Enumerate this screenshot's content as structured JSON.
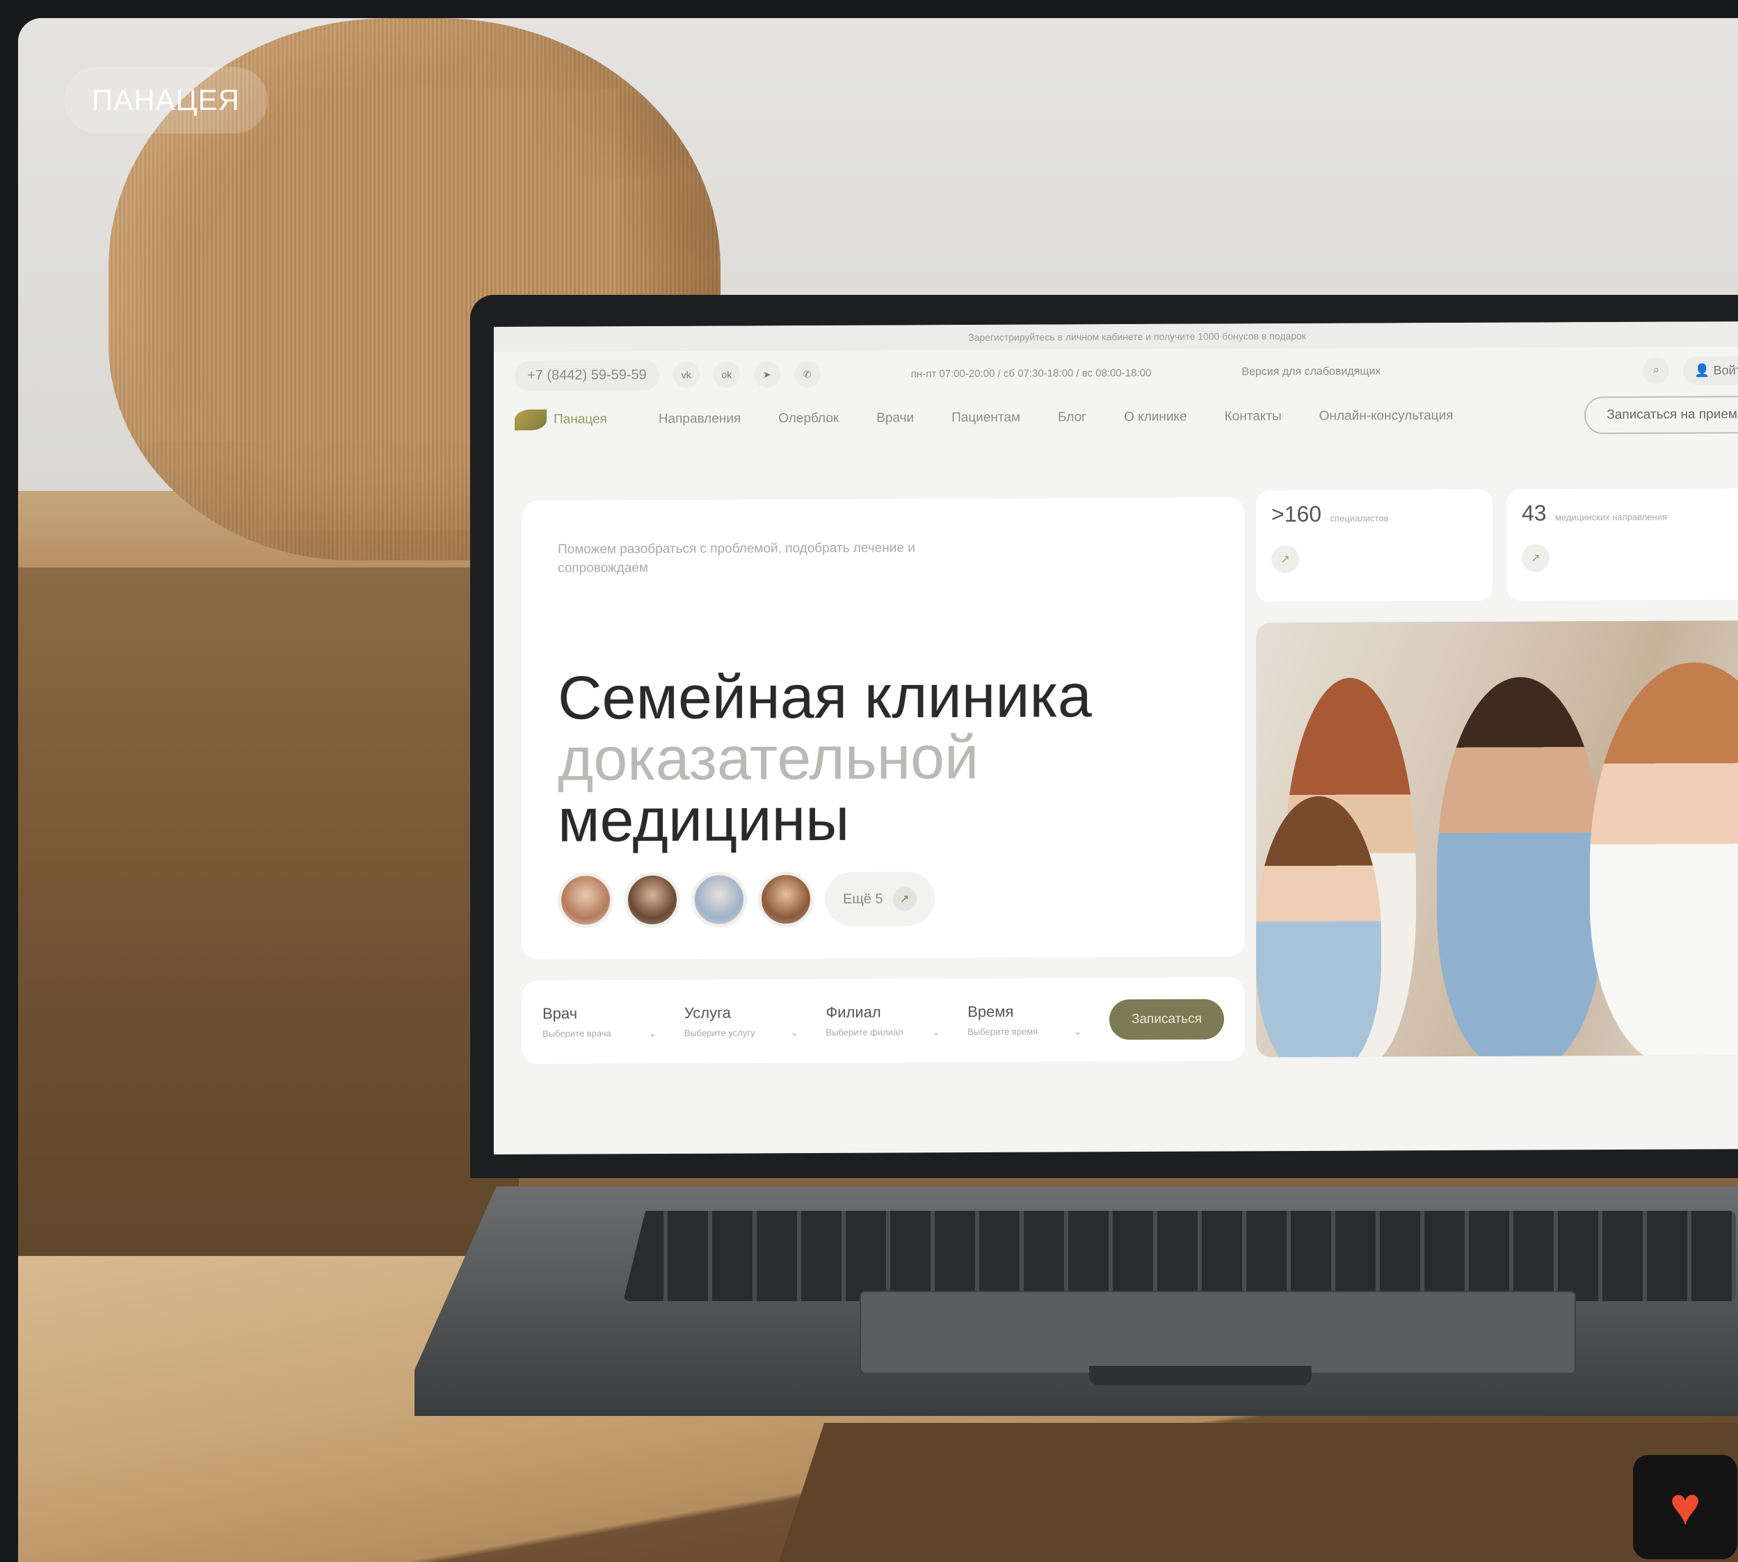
{
  "brand": {
    "pill_label": "ПАНАЦЕЯ"
  },
  "site": {
    "topbar": {
      "text": "Зарегистрируйтесь в личном кабинете и получите 1000 бонусов в подарок",
      "close": "×"
    },
    "header": {
      "phone": "+7 (8442) 59-59-59",
      "social_icons": [
        "vk-icon",
        "ok-icon",
        "telegram-icon",
        "whatsapp-icon"
      ],
      "hours": "пн-пт 07:00-20:00 / сб 07:30-18:00 / вс 08:00-18:00",
      "accessibility": "Версия для слабовидящих",
      "login": "Войти"
    },
    "nav": {
      "logo_text": "Панацея",
      "items": [
        "Направления",
        "Олерблок",
        "Врачи",
        "Пациентам",
        "Блог",
        "О клинике",
        "Контакты",
        "Онлайн-консультация"
      ],
      "cta": "Записаться на прием"
    },
    "hero": {
      "subtitle": "Поможем разобраться с проблемой, подобрать лечение и сопровождаем",
      "title_line1": "Семейная клиника",
      "title_line2": "доказательной",
      "title_line3": "медицины",
      "more_label": "Ещё 5",
      "more_icon": "↗"
    },
    "stats": [
      {
        "number": ">160",
        "label": "специалистов",
        "icon": "↗"
      },
      {
        "number": "43",
        "label": "медицинских направления",
        "icon": "↗"
      }
    ],
    "booking": {
      "fields": [
        {
          "label": "Врач",
          "placeholder": "Выберите врача"
        },
        {
          "label": "Услуга",
          "placeholder": "Выберите услугу"
        },
        {
          "label": "Филиал",
          "placeholder": "Выберите филиал"
        },
        {
          "label": "Время",
          "placeholder": "Выберите время"
        }
      ],
      "button": "Записаться"
    }
  },
  "favorite": {
    "icon": "heart-icon",
    "color": "#ee4d2d"
  },
  "colors": {
    "accent": "#7d7b53",
    "background": "#16181a"
  }
}
